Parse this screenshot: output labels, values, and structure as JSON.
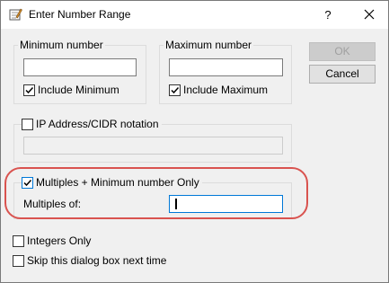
{
  "window": {
    "title": "Enter Number Range",
    "help_label": "?"
  },
  "minimum": {
    "group_label": "Minimum number",
    "value": "",
    "include_label": "Include Minimum",
    "include_checked": true
  },
  "maximum": {
    "group_label": "Maximum number",
    "value": "",
    "include_label": "Include Maximum",
    "include_checked": true
  },
  "buttons": {
    "ok_label": "OK",
    "cancel_label": "Cancel"
  },
  "ip": {
    "label": "IP Address/CIDR notation",
    "checked": false,
    "value": ""
  },
  "multiples": {
    "label": "Multiples + Minimum number Only",
    "checked": true,
    "field_label": "Multiples of:",
    "value": ""
  },
  "options": {
    "integers_label": "Integers Only",
    "integers_checked": false,
    "skip_label": "Skip this dialog box next time",
    "skip_checked": false
  },
  "colors": {
    "highlight": "#d9534f",
    "focus_border": "#0078d7",
    "dialog_bg": "#f0f0f0"
  }
}
